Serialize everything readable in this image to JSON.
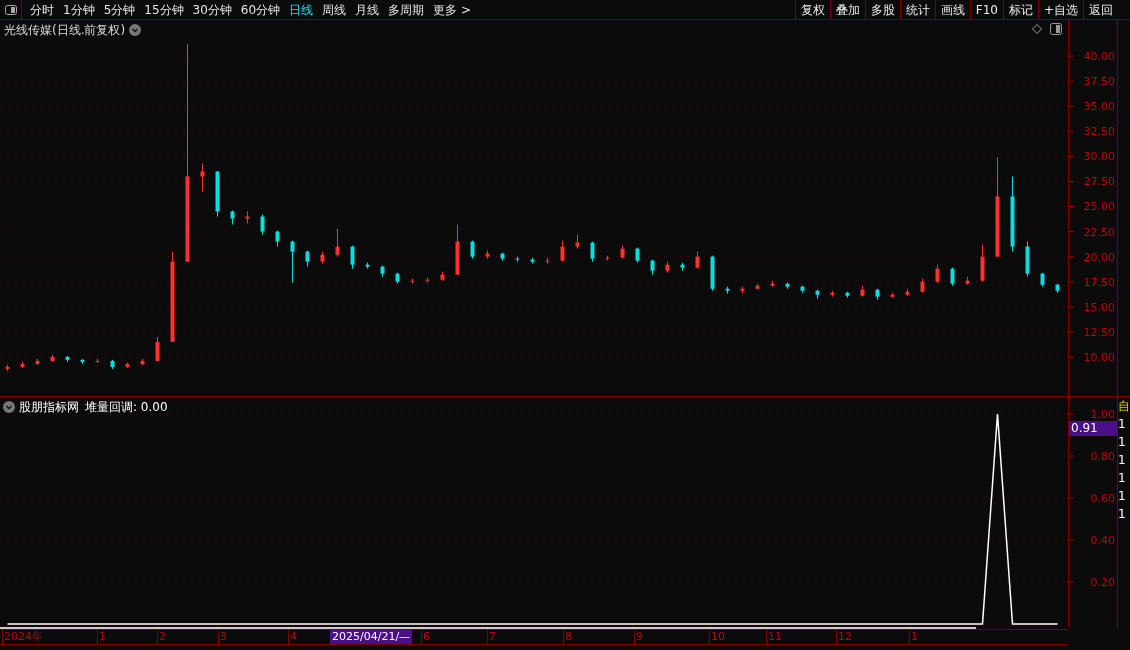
{
  "toolbar": {
    "periods": [
      {
        "label": "分时",
        "selected": false
      },
      {
        "label": "1分钟",
        "selected": false
      },
      {
        "label": "5分钟",
        "selected": false
      },
      {
        "label": "15分钟",
        "selected": false
      },
      {
        "label": "30分钟",
        "selected": false
      },
      {
        "label": "60分钟",
        "selected": false
      },
      {
        "label": "日线",
        "selected": true
      },
      {
        "label": "周线",
        "selected": false
      },
      {
        "label": "月线",
        "selected": false
      },
      {
        "label": "多周期",
        "selected": false
      },
      {
        "label": "更多 >",
        "selected": false
      }
    ],
    "actions": [
      "复权",
      "叠加",
      "多股",
      "统计",
      "画线",
      "F10",
      "标记",
      "+自选",
      "返回"
    ]
  },
  "price_panel": {
    "title": "光线传媒(日线.前复权)",
    "chart_data": {
      "type": "candlestick",
      "grid": true,
      "ylim": [
        6.1,
        43.6
      ],
      "yticks": [
        {
          "value": 40,
          "label": "40.00"
        },
        {
          "value": 37.5,
          "label": "37.50"
        },
        {
          "value": 35,
          "label": "35.00"
        },
        {
          "value": 32.5,
          "label": "32.50"
        },
        {
          "value": 30,
          "label": "30.00"
        },
        {
          "value": 27.5,
          "label": "27.50"
        },
        {
          "value": 25,
          "label": "25.00"
        },
        {
          "value": 22.5,
          "label": "22.50"
        },
        {
          "value": 20,
          "label": "20.00"
        },
        {
          "value": 17.5,
          "label": "17.50"
        },
        {
          "value": 15,
          "label": "15.00"
        },
        {
          "value": 12.5,
          "label": "12.50"
        },
        {
          "value": 10,
          "label": "10.00"
        }
      ],
      "ohlc": [
        [
          8.8,
          9.2,
          8.6,
          9.0
        ],
        [
          9.0,
          9.5,
          8.9,
          9.3
        ],
        [
          9.3,
          9.8,
          9.2,
          9.6
        ],
        [
          9.6,
          10.2,
          9.5,
          10.0
        ],
        [
          10.0,
          10.1,
          9.5,
          9.7
        ],
        [
          9.7,
          9.8,
          9.3,
          9.5
        ],
        [
          9.5,
          9.8,
          9.4,
          9.6
        ],
        [
          9.6,
          9.7,
          8.8,
          9.0
        ],
        [
          9.0,
          9.4,
          8.9,
          9.3
        ],
        [
          9.3,
          9.8,
          9.2,
          9.6
        ],
        [
          9.6,
          12.0,
          9.6,
          11.5
        ],
        [
          11.5,
          20.5,
          11.5,
          19.5
        ],
        [
          19.5,
          41.2,
          19.5,
          28
        ],
        [
          28,
          29.3,
          26.5,
          28.5
        ],
        [
          28.5,
          28.5,
          24,
          24.5
        ],
        [
          24.5,
          24.6,
          23.2,
          23.8
        ],
        [
          23.8,
          24.5,
          23.3,
          24
        ],
        [
          24,
          24.2,
          22.2,
          22.5
        ],
        [
          22.5,
          22.6,
          21,
          21.5
        ],
        [
          21.5,
          21.6,
          17.4,
          20.5
        ],
        [
          20.5,
          20.6,
          19,
          19.5
        ],
        [
          19.5,
          20.5,
          19.3,
          20.2
        ],
        [
          20.2,
          22.8,
          20,
          21
        ],
        [
          21,
          21.1,
          18.8,
          19.2
        ],
        [
          19.2,
          19.4,
          18.8,
          19
        ],
        [
          19,
          19.1,
          18,
          18.3
        ],
        [
          18.3,
          18.4,
          17.3,
          17.5
        ],
        [
          17.5,
          17.8,
          17.3,
          17.6
        ],
        [
          17.6,
          17.9,
          17.4,
          17.7
        ],
        [
          17.7,
          18.5,
          17.6,
          18.2
        ],
        [
          18.2,
          23.2,
          18.2,
          21.5
        ],
        [
          21.5,
          21.6,
          19.8,
          20
        ],
        [
          20,
          20.6,
          19.8,
          20.3
        ],
        [
          20.3,
          20.4,
          19.6,
          19.8
        ],
        [
          19.8,
          20,
          19.5,
          19.7
        ],
        [
          19.7,
          19.9,
          19.3,
          19.5
        ],
        [
          19.5,
          19.9,
          19.3,
          19.6
        ],
        [
          19.6,
          21.6,
          19.5,
          21
        ],
        [
          21,
          22.2,
          20.8,
          21.4
        ],
        [
          21.4,
          21.5,
          19.5,
          19.8
        ],
        [
          19.8,
          20.1,
          19.6,
          19.9
        ],
        [
          19.9,
          21.1,
          19.8,
          20.8
        ],
        [
          20.8,
          20.9,
          19.4,
          19.6
        ],
        [
          19.6,
          19.7,
          18.2,
          18.6
        ],
        [
          18.6,
          19.5,
          18.4,
          19.2
        ],
        [
          19.2,
          19.4,
          18.6,
          18.9
        ],
        [
          18.9,
          20.5,
          18.8,
          20
        ],
        [
          20,
          20.1,
          16.6,
          16.8
        ],
        [
          16.8,
          17,
          16.3,
          16.6
        ],
        [
          16.6,
          17,
          16.4,
          16.8
        ],
        [
          16.8,
          17.3,
          16.7,
          17.1
        ],
        [
          17.1,
          17.6,
          17,
          17.3
        ],
        [
          17.3,
          17.4,
          16.8,
          17
        ],
        [
          17,
          17.1,
          16.4,
          16.6
        ],
        [
          16.6,
          16.7,
          15.8,
          16.2
        ],
        [
          16.2,
          16.6,
          16,
          16.4
        ],
        [
          16.4,
          16.5,
          15.9,
          16.1
        ],
        [
          16.1,
          17.1,
          16,
          16.7
        ],
        [
          16.7,
          16.8,
          15.7,
          16
        ],
        [
          16,
          16.4,
          15.9,
          16.2
        ],
        [
          16.2,
          16.8,
          16.1,
          16.5
        ],
        [
          16.5,
          17.8,
          16.4,
          17.5
        ],
        [
          17.5,
          19.2,
          17.4,
          18.8
        ],
        [
          18.8,
          18.9,
          17.1,
          17.3
        ],
        [
          17.3,
          18,
          17.2,
          17.6
        ],
        [
          17.6,
          21.2,
          17.5,
          20
        ],
        [
          20,
          29.9,
          20,
          26
        ],
        [
          26,
          28,
          20.5,
          21
        ],
        [
          21,
          21.5,
          18,
          18.3
        ],
        [
          18.3,
          18.4,
          17,
          17.2
        ],
        [
          17.2,
          17.3,
          16.4,
          16.6
        ]
      ]
    }
  },
  "indicator_panel": {
    "title": "股朋指标网",
    "legend_value": ": 0.00",
    "readout": "0.91",
    "chart_data": {
      "type": "line",
      "grid": true,
      "ylim": [
        -0.014,
        1.081
      ],
      "yticks": [
        {
          "value": 1,
          "label": "1.00"
        },
        {
          "value": 0.8,
          "label": "0.80"
        },
        {
          "value": 0.6,
          "label": "0.60"
        },
        {
          "value": 0.4,
          "label": "0.40"
        },
        {
          "value": 0.2,
          "label": "0.20"
        }
      ],
      "series": [
        {
          "name": "堆量回调",
          "color": "#ffffff",
          "values": [
            0,
            0,
            0,
            0,
            0,
            0,
            0,
            0,
            0,
            0,
            0,
            0,
            0,
            0,
            0,
            0,
            0,
            0,
            0,
            0,
            0,
            0,
            0,
            0,
            0,
            0,
            0,
            0,
            0,
            0,
            0,
            0,
            0,
            0,
            0,
            0,
            0,
            0,
            0,
            0,
            0,
            0,
            0,
            0,
            0,
            0,
            0,
            0,
            0,
            0,
            0,
            0,
            0,
            0,
            0,
            0,
            0,
            0,
            0,
            0,
            0,
            0,
            0,
            0,
            0,
            0,
            1,
            0,
            0,
            0,
            0
          ]
        }
      ]
    }
  },
  "time_axis": [
    {
      "label": "2024年",
      "highlighted": false
    },
    {
      "label": "1",
      "highlighted": false
    },
    {
      "label": "2",
      "highlighted": false
    },
    {
      "label": "3",
      "highlighted": false
    },
    {
      "label": "4",
      "highlighted": false
    },
    {
      "label": "2025/04/21/—",
      "highlighted": true
    },
    {
      "label": "6",
      "highlighted": false
    },
    {
      "label": "7",
      "highlighted": false
    },
    {
      "label": "8",
      "highlighted": false
    },
    {
      "label": "9",
      "highlighted": false
    },
    {
      "label": "10",
      "highlighted": false
    },
    {
      "label": "11",
      "highlighted": false
    },
    {
      "label": "12",
      "highlighted": false
    },
    {
      "label": "1",
      "highlighted": false
    }
  ],
  "side_column": [
    "自",
    "1",
    "1",
    "1",
    "1",
    "1",
    "1"
  ]
}
